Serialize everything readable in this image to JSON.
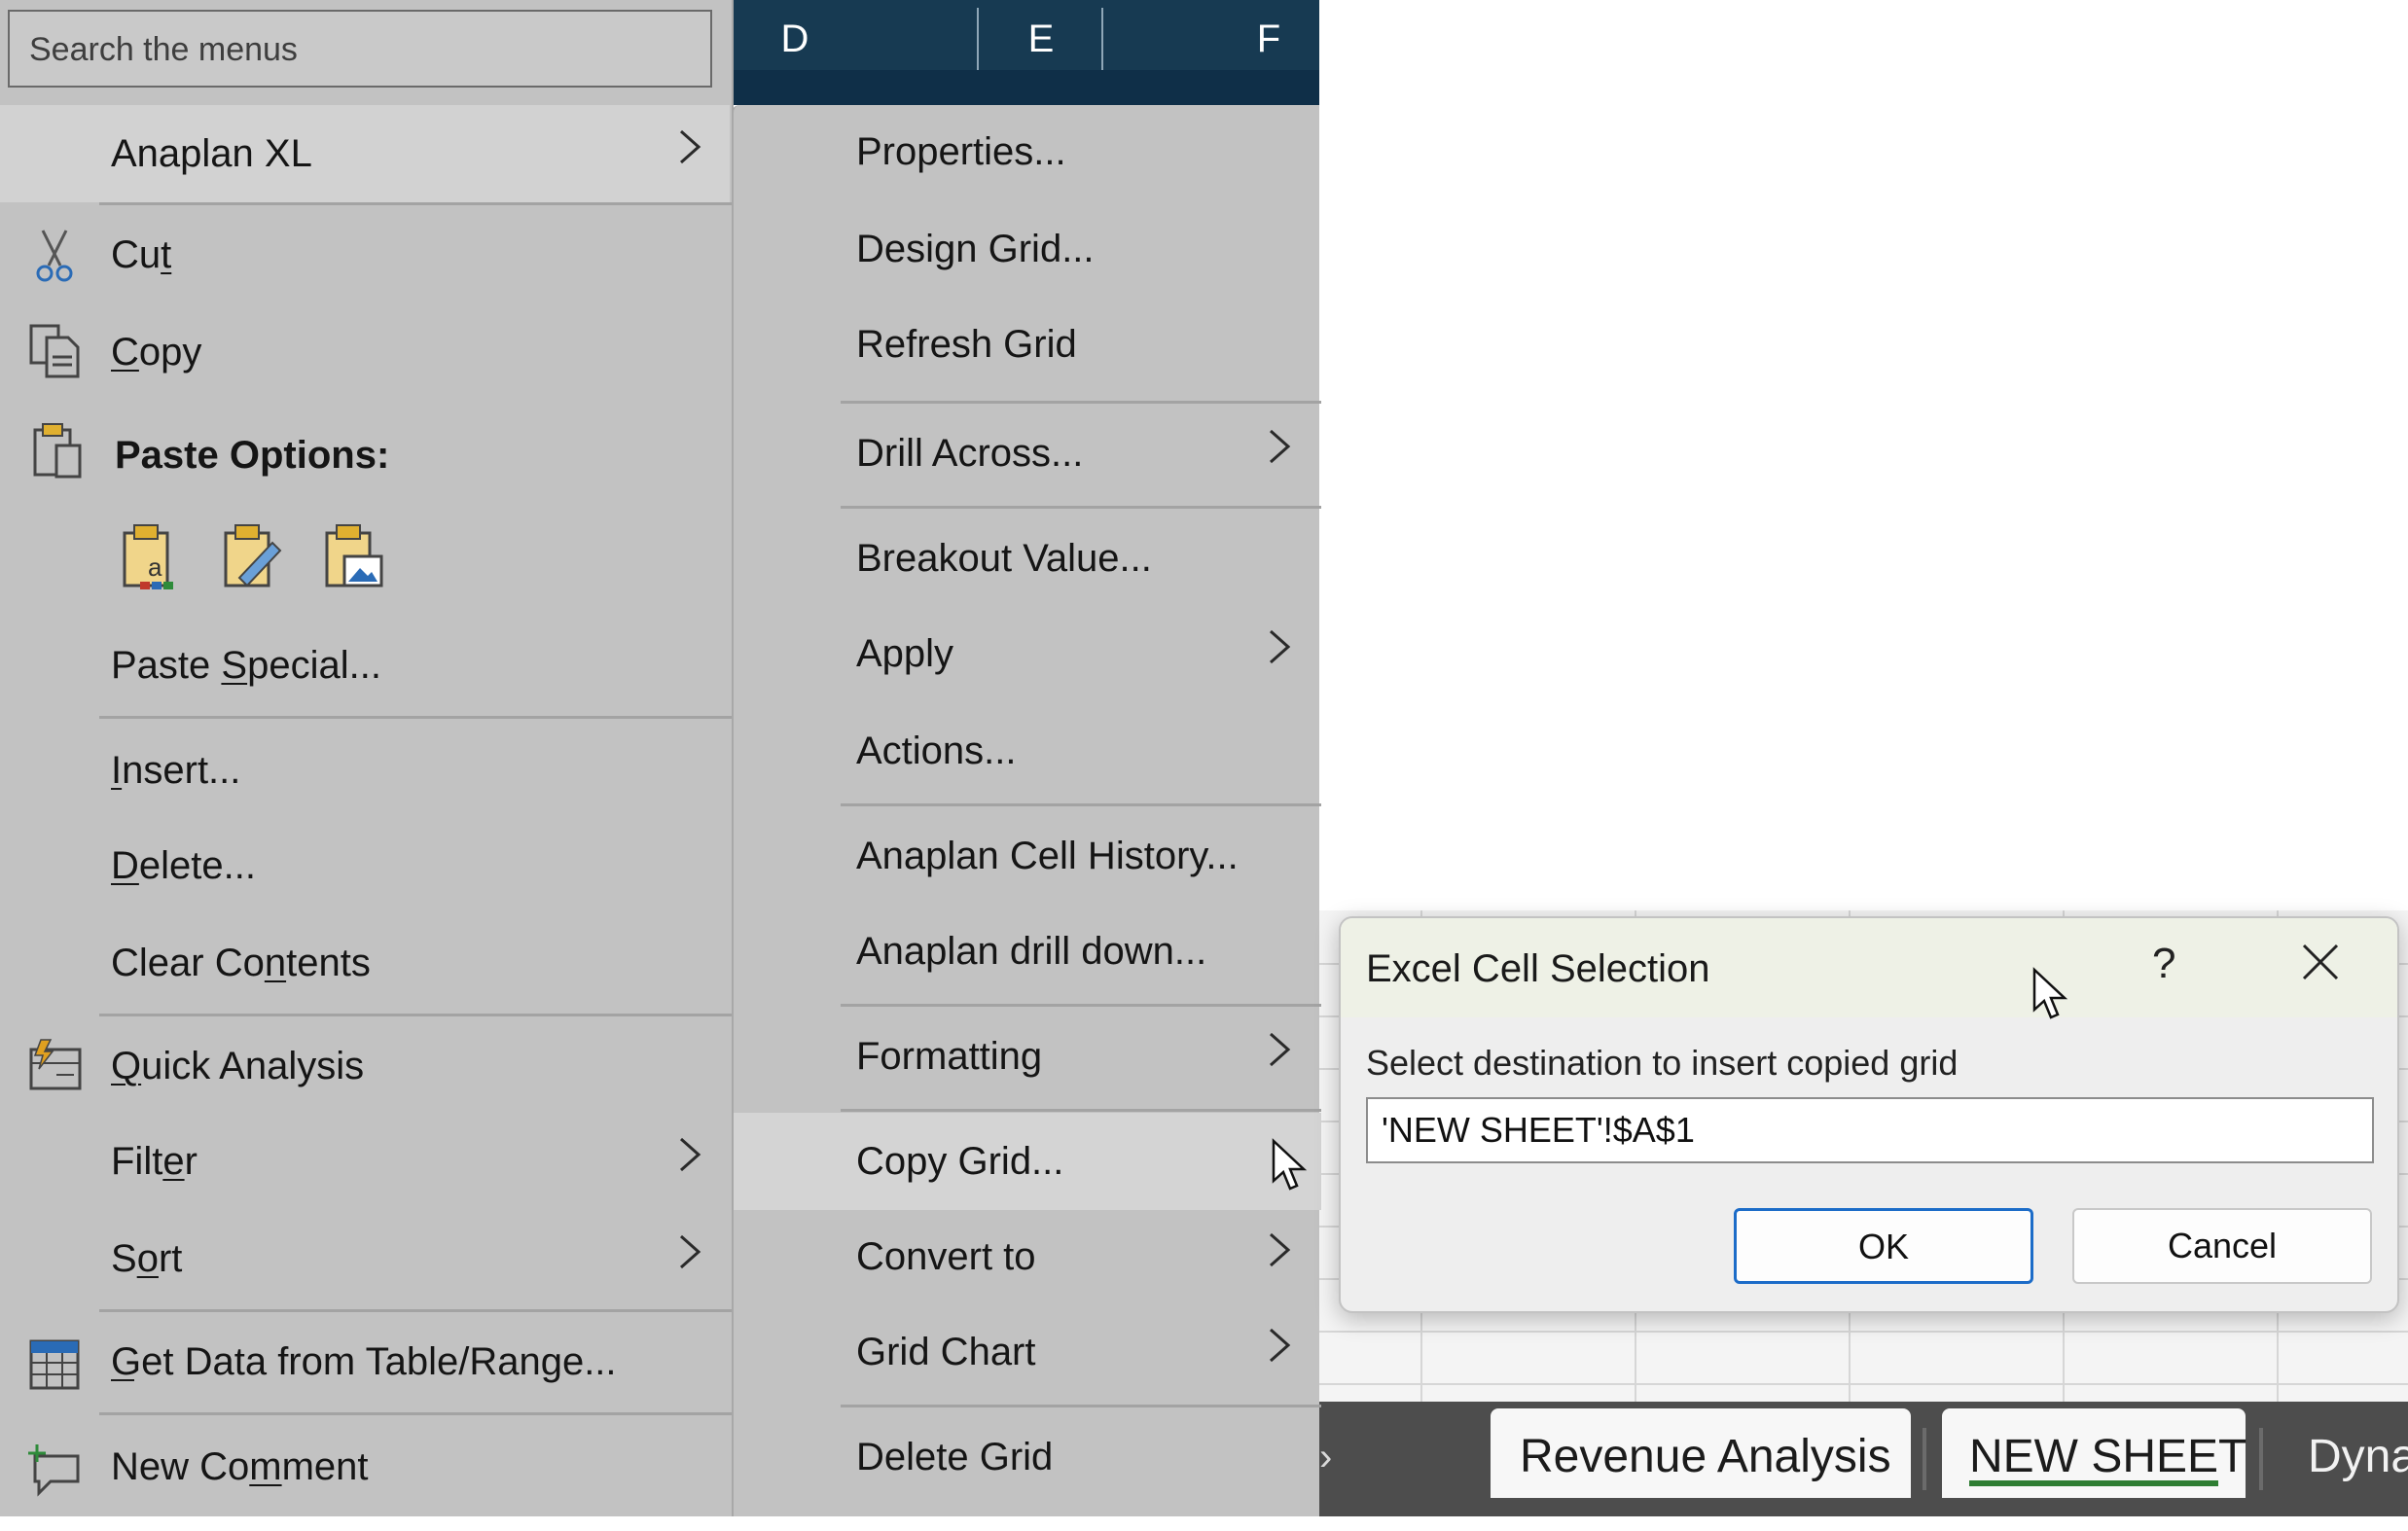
{
  "spreadsheet": {
    "columns": [
      "D",
      "E",
      "F"
    ],
    "sheet_tabs": [
      "Revenue Analysis",
      "NEW SHEET",
      "Dyna"
    ],
    "active_tab": "NEW SHEET",
    "tab_nav_glyph": "›"
  },
  "context_menu": {
    "search_placeholder": "Search the menus",
    "anaplan": "Anaplan XL",
    "cut": {
      "pre": "Cu",
      "key": "t",
      "post": ""
    },
    "copy": {
      "pre": "",
      "key": "C",
      "post": "opy"
    },
    "paste_options": "Paste Options:",
    "paste_special": {
      "pre": "Paste ",
      "key": "S",
      "post": "pecial..."
    },
    "insert": {
      "pre": "",
      "key": "I",
      "post": "nsert..."
    },
    "delete": {
      "pre": "",
      "key": "D",
      "post": "elete..."
    },
    "clear_contents": {
      "pre": "Clear Co",
      "key": "n",
      "post": "tents"
    },
    "quick_analysis": {
      "pre": "",
      "key": "Q",
      "post": "uick Analysis"
    },
    "filter": {
      "pre": "Filt",
      "key": "e",
      "post": "r"
    },
    "sort": {
      "pre": "S",
      "key": "o",
      "post": "rt"
    },
    "get_data": {
      "pre": "Get Data from Table/Range...",
      "key": "",
      "post": ""
    },
    "new_comment": {
      "pre": "New Co",
      "key": "m",
      "post": "ment"
    },
    "arrow_glyph": ">"
  },
  "submenu": {
    "items": [
      "Properties...",
      "Design Grid...",
      "Refresh Grid",
      "Drill Across...",
      "Breakout Value...",
      "Apply",
      "Actions...",
      "Anaplan Cell History...",
      "Anaplan drill down...",
      "Formatting",
      "Copy Grid...",
      "Convert to",
      "Grid Chart",
      "Delete Grid"
    ],
    "highlighted": "Copy Grid..."
  },
  "dialog": {
    "title": "Excel Cell Selection",
    "help_glyph": "?",
    "prompt": "Select destination to insert copied grid",
    "input_value": "'NEW SHEET'!$A$1",
    "ok_label": "OK",
    "cancel_label": "Cancel"
  },
  "icons": {
    "cut": "scissors-icon",
    "copy": "copy-icon",
    "paste": "clipboard-icon",
    "quick_analysis": "quick-analysis-icon",
    "get_data": "table-icon",
    "new_comment": "new-comment-icon"
  },
  "colors": {
    "menu_bg": "#c2c2c2",
    "menu_highlight": "#d2d2d2",
    "column_header": "#173a52",
    "ok_button_border": "#1c6cc8",
    "active_tab_underline": "#2e7d32"
  }
}
